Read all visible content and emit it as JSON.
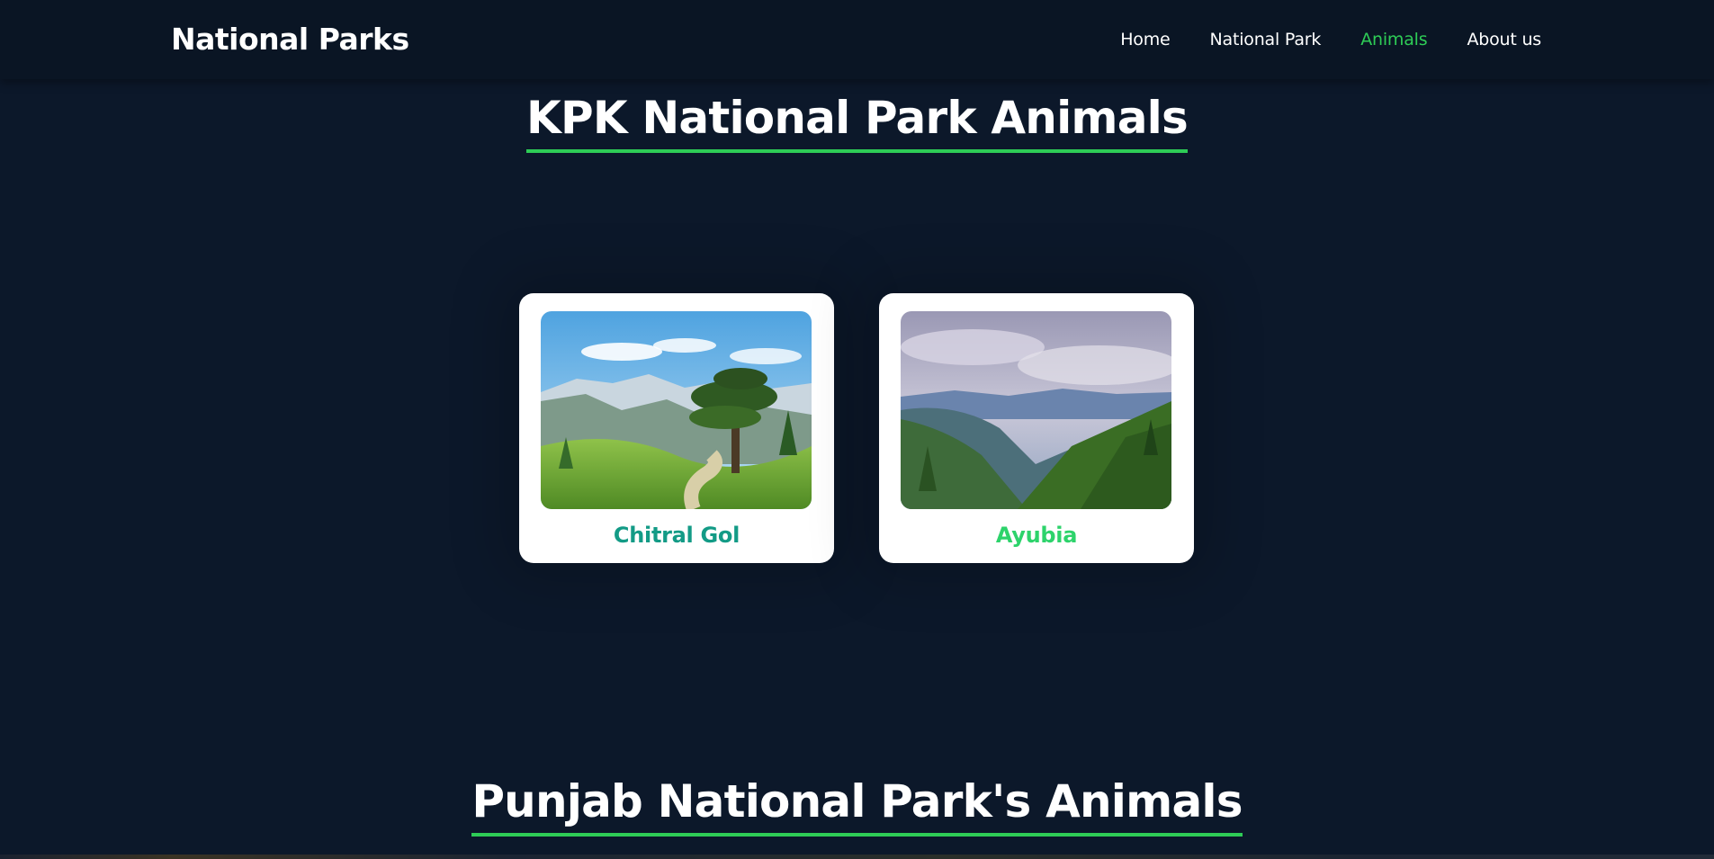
{
  "nav": {
    "brand": "National Parks",
    "links": [
      {
        "label": "Home",
        "active": false
      },
      {
        "label": "National Park",
        "active": false
      },
      {
        "label": "Animals",
        "active": true
      },
      {
        "label": "About us",
        "active": false
      }
    ]
  },
  "sections": {
    "kpk": {
      "title": "KPK National Park Animals",
      "cards": [
        {
          "title": "Chitral Gol",
          "image": "tree-mountain-path-photo",
          "title_color": "#139b86"
        },
        {
          "title": "Ayubia",
          "image": "forest-valley-photo",
          "title_color": "#2dd36b"
        }
      ]
    },
    "punjab": {
      "title": "Punjab National Park's Animals"
    }
  },
  "colors": {
    "background": "#0c182a",
    "navbar": "#0a1524",
    "accent": "#2ecc56"
  }
}
